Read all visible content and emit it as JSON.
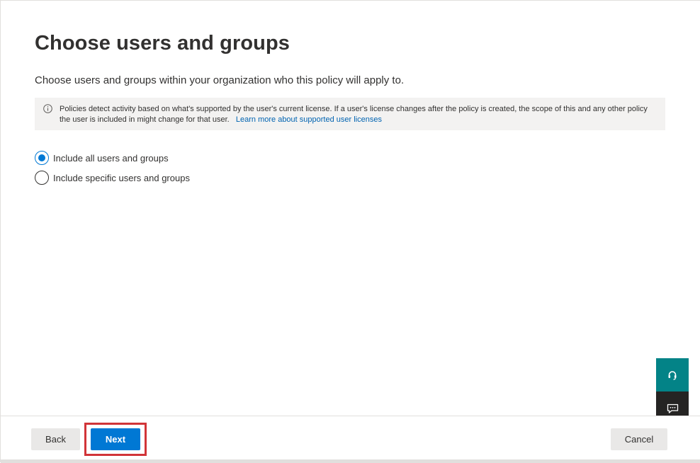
{
  "page": {
    "title": "Choose users and groups",
    "description": "Choose users and groups within your organization who this policy will apply to."
  },
  "info": {
    "text": "Policies detect activity based on what's supported by the user's current license. If a user's license changes after the policy is created, the scope of this and any other policy the user is included in might change for that user.",
    "link": "Learn more about supported user licenses"
  },
  "options": [
    {
      "label": "Include all users and groups",
      "selected": true
    },
    {
      "label": "Include specific users and groups",
      "selected": false
    }
  ],
  "footer": {
    "back_label": "Back",
    "next_label": "Next",
    "cancel_label": "Cancel"
  },
  "colors": {
    "accent": "#0078d4",
    "help_button": "#038387",
    "feedback_button": "#252423",
    "highlight": "#d13438"
  },
  "side_buttons": {
    "help_icon": "headset-icon",
    "feedback_icon": "feedback-icon"
  }
}
